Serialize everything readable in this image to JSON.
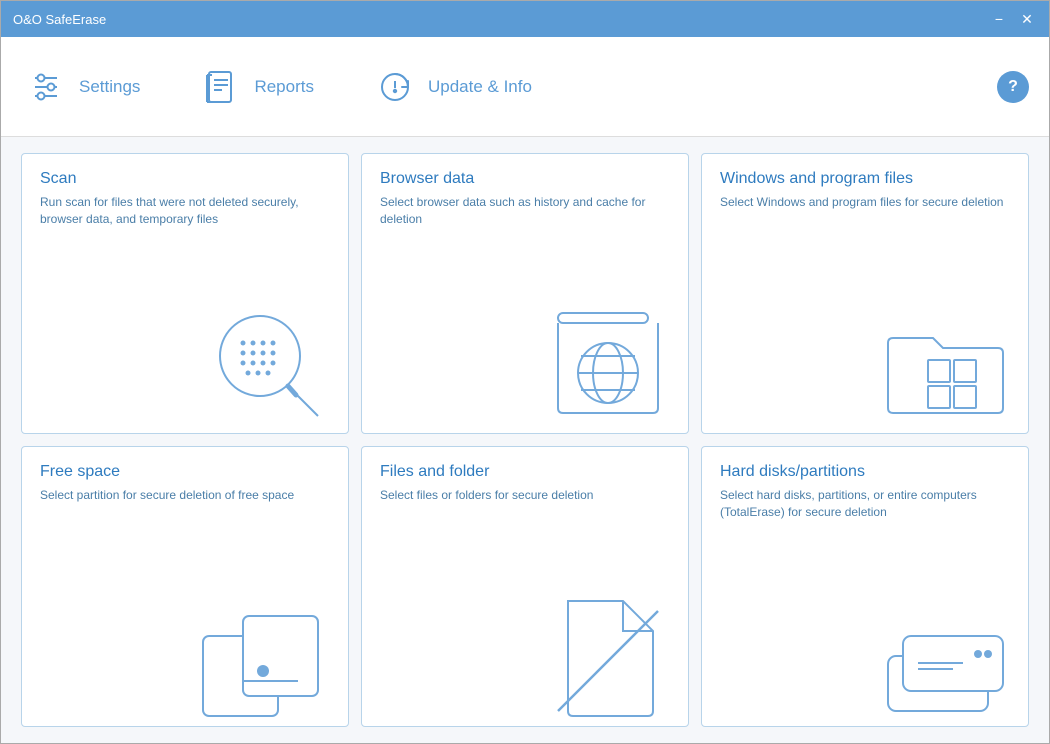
{
  "window": {
    "title": "O&O SafeErase",
    "min_label": "−",
    "close_label": "✕"
  },
  "toolbar": {
    "settings_label": "Settings",
    "reports_label": "Reports",
    "update_label": "Update & Info",
    "help_label": "?"
  },
  "cards": [
    {
      "id": "scan",
      "title": "Scan",
      "desc": "Run scan for files that were not deleted securely, browser data, and temporary files"
    },
    {
      "id": "browser",
      "title": "Browser data",
      "desc": "Select browser data such as history and cache for deletion"
    },
    {
      "id": "windows",
      "title": "Windows and program files",
      "desc": "Select Windows and program files for secure deletion"
    },
    {
      "id": "freespace",
      "title": "Free space",
      "desc": "Select partition for secure deletion of free space"
    },
    {
      "id": "files",
      "title": "Files and folder",
      "desc": "Select files or folders for secure deletion"
    },
    {
      "id": "harddisks",
      "title": "Hard disks/partitions",
      "desc": "Select hard disks, partitions, or entire computers (TotalErase) for secure deletion"
    }
  ]
}
